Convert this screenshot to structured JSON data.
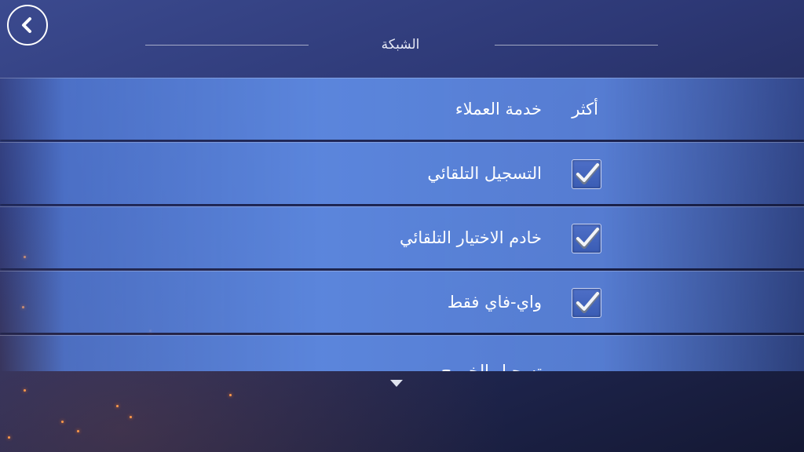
{
  "header": {
    "title": "الشبكة",
    "back_icon": "chevron-left-icon"
  },
  "rows": [
    {
      "label": "خدمة العملاء",
      "more_label": "أكثر",
      "type": "link"
    },
    {
      "label": "التسجيل التلقائي",
      "checked": true,
      "type": "checkbox"
    },
    {
      "label": "خادم الاختيار التلقائي",
      "checked": true,
      "type": "checkbox"
    },
    {
      "label": "واي-فاي فقط",
      "checked": true,
      "type": "checkbox"
    },
    {
      "label": "تسجيل الخروج",
      "type": "link"
    }
  ],
  "footer": {
    "scroll_icon": "triangle-down-icon"
  },
  "colors": {
    "row_blue": "#5c87de",
    "background_dark": "#1f2650",
    "text": "#ffffff"
  }
}
